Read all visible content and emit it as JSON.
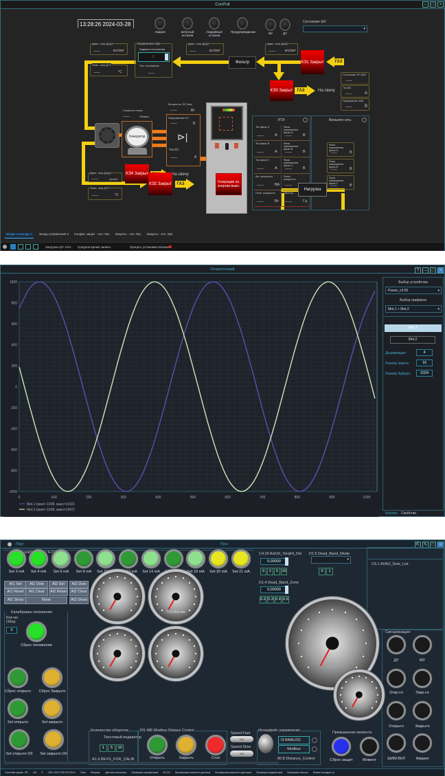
{
  "scada": {
    "title": "ConPult",
    "clock": "13:28:26  2024-03-28",
    "indicators": [
      "Авария",
      "Штатный останов",
      "Аварийный останов",
      "Предупреждение",
      "МУ",
      "ДУ"
    ],
    "state_label": "Состояние ШУ",
    "state_value": "",
    "sensors": {
      "dad3": {
        "label": "Давл. газа ДАД3",
        "unit": "кгс/см²"
      },
      "dt1": {
        "label": "Темп. газа ДТ1",
        "unit": "°C"
      },
      "dad2": {
        "label": "Давл. газа ДАД2",
        "unit": "кгс/см²"
      },
      "dad1": {
        "label": "Давл. газа ДАД1",
        "unit": "кгс/см²"
      },
      "dad4": {
        "label": "Давл. газа ДАД4",
        "unit": "кгс/см²"
      },
      "dt2": {
        "label": "Темп. газа ДТ2",
        "unit": "°C"
      }
    },
    "rd1": {
      "title": "Управление РД1",
      "setpoint_label": "Задание положения",
      "setpoint_value": "0",
      "pos_label": "Тек. положение"
    },
    "filter": "Фильтр",
    "valves": {
      "ke1": "КЭ1 Закрыт",
      "ke3": "КЭ3 Закрыт",
      "ke4": "КЭ4 Закрыт",
      "ke2": "КЭ2 Закрыт"
    },
    "gas": "ГАЗ",
    "to_candle": "На свечу",
    "battery": [
      {
        "label": "Состояние ЭУ АБЭ",
        "unit": ""
      },
      {
        "label": "Ток АБ",
        "unit": "A"
      },
      {
        "label": "Напряжение АКБ",
        "unit": "В"
      }
    ],
    "speed": {
      "label": "Скорость генер.",
      "unit": "Об/мин"
    },
    "generator": "Генератор",
    "converter": [
      {
        "label": "Мощность ЭС Вых",
        "unit": "Вт"
      },
      {
        "label": "Напряжение DC",
        "unit": "В"
      },
      {
        "label": "Ток DC",
        "unit": "A"
      }
    ],
    "gen_button": "Генерация эл. энергии выкл.",
    "upe": {
      "title": "УПЭ",
      "cells": [
        {
          "label": "Ток фазы A",
          "unit": "A"
        },
        {
          "label": "Фаза напряжения фазы A",
          "unit": "В"
        },
        {
          "label": "Ток фазы B",
          "unit": "A"
        },
        {
          "label": "Фаза напряжения фазы B",
          "unit": "В"
        },
        {
          "label": "Ток фазы C",
          "unit": "A"
        },
        {
          "label": "Фаза напряжения фазы C",
          "unit": "В"
        },
        {
          "label": "Акт. мощность",
          "unit": "ВА"
        },
        {
          "label": "Реакт. мощность",
          "unit": "ВАр"
        },
        {
          "label": "Полн. мощность",
          "unit": "Вт"
        },
        {
          "label": "Частота",
          "unit": "Гц"
        }
      ]
    },
    "grid": {
      "title": "Внешняя сеть",
      "cells": [
        {
          "label": "Фаза напряжения фазы A",
          "unit": "В"
        },
        {
          "label": "Фаза напряжения фазы B",
          "unit": "В"
        },
        {
          "label": "Фаза напряжения фазы C",
          "unit": "В"
        }
      ]
    },
    "load": "Нагрузка",
    "tabs": [
      "Входы и выходы 1",
      "Входы управления 2",
      "Конфиг. защит - хол. №1",
      "Защиты - хол. №1",
      "Защиты - хол. №2"
    ],
    "status": {
      "cpu": "Загрузка ЦП: 21%",
      "write": "Средняя время записи",
      "process": "Процесс установки питания"
    }
  },
  "scope": {
    "title": "Осциллограф",
    "device_label": "Выбор устройства",
    "device_value": "Power_v3.55",
    "graphs_label": "Выбор графиков",
    "graphs_value": "Mot.1 + Mot.2",
    "channels": [
      "Mot.1",
      "Mot.2"
    ],
    "decimation_label": "Дециммация",
    "decimation_value": "4",
    "packet_label": "Размер пакета",
    "packet_value": "16",
    "buffer_label": "Размер буфера",
    "buffer_value": "1024",
    "tabs": [
      "Каналы",
      "Свойства"
    ],
    "legend": [
      "Mot.1   (мин=-1008, макс=1010)",
      "Mot.2   (мин=-1008, макс=1007)"
    ]
  },
  "chart_data": {
    "type": "line",
    "title": "",
    "xlabel": "",
    "ylabel": "",
    "xlim": [
      0,
      1030
    ],
    "ylim": [
      -1000,
      1000
    ],
    "xticks": [
      0,
      100,
      200,
      300,
      400,
      500,
      600,
      700,
      800,
      900,
      1000
    ],
    "yticks": [
      -1000,
      -800,
      -600,
      -400,
      -200,
      0,
      200,
      400,
      600,
      800,
      1000
    ],
    "grid": true,
    "legend_position": "bottom-left",
    "x": [
      0,
      32,
      64,
      96,
      128,
      160,
      192,
      224,
      256,
      288,
      320,
      352,
      384,
      416,
      448,
      480,
      512,
      544,
      576,
      608,
      640,
      672,
      704,
      736,
      768,
      800,
      832,
      864,
      896,
      928,
      960,
      992,
      1024
    ],
    "series": [
      {
        "name": "Mot.1",
        "color": "#5b4fb0",
        "values": [
          746,
          947,
          997,
          888,
          637,
          285,
          -113,
          -493,
          -794,
          -969,
          -989,
          -851,
          -577,
          -212,
          187,
          557,
          838,
          985,
          975,
          809,
          514,
          138,
          -261,
          -618,
          -876,
          -995,
          -955,
          -762,
          -448,
          -63,
          333,
          675,
          910
        ]
      },
      {
        "name": "Mot.2",
        "color": "#cfe6b8",
        "values": [
          187,
          -212,
          -578,
          -851,
          -989,
          -969,
          -794,
          -493,
          -113,
          285,
          637,
          888,
          997,
          947,
          746,
          426,
          38,
          -356,
          -694,
          -920,
          -1000,
          -920,
          -694,
          -356,
          38,
          426,
          746,
          947,
          997,
          888,
          637,
          285,
          -113
        ]
      }
    ]
  },
  "control": {
    "top_left": "Порт",
    "top_center": "Пуск",
    "calib_title": "Калибровка AI 4-21",
    "set_lamps": [
      "Set 3 mA",
      "Set 4 mA",
      "Set 6 mA",
      "Set 8 mA",
      "Set 10 mA",
      "Set 12 mA",
      "Set 14 mA",
      "Set 16 mA",
      "Set 18 mA",
      "Set 20 mA",
      "Set 21 mA"
    ],
    "set_lamp_colors": [
      "#27e027",
      "#27e027",
      "#8ee08e",
      "#2f9a35",
      "#8ee08e",
      "#2f9a35",
      "#8ee08e",
      "#2f9a35",
      "#8ee08e",
      "#e8e620",
      "#e8e620"
    ],
    "ai_buttons": [
      "AI1 Set",
      "AI1 Dots",
      "AI2 Set",
      "AI2 Dots",
      "AI1 Reset",
      "AI1 Clear",
      "AI2 Reset",
      "AI2 Clear",
      "AI1 Show",
      "None",
      "AI2 Show"
    ],
    "gauge_label": "TCh Rot sek",
    "torq_label": "C4.29 AnCtrl_TorqFlt_Del",
    "torq_value": "0,00000",
    "torq_buttons": [
      "0",
      "2",
      "5",
      "10"
    ],
    "dbmode_label": "D1.5 Dead_Band_Mode",
    "dbmode_buttons": [
      "0",
      "1"
    ],
    "dbzone_label": "D1.4 Dead_Band_Zone",
    "dbzone_value": "0,00000",
    "dbzone_buttons": [
      "0.2",
      "0.3",
      "0.4",
      "0.5"
    ],
    "dots_list": "C6.1 AI/AO_Dots_List",
    "pos_calib": {
      "title": "Калибровка положения",
      "count_label": "Кол-во Обор",
      "count_value": "0",
      "lamps": [
        "Сброс положения",
        "Сброс открыто",
        "Сброс Закрыто",
        "Set открыто",
        "Set закрыто",
        "Set открыто Об",
        "Set закрыто Об"
      ]
    },
    "revs": {
      "title": "Количество оборотов",
      "indicator": "Текстовый индикатор",
      "buttons": [
        "1",
        "5",
        "10"
      ],
      "param": "A1.9 REVS_FOR_CALIB"
    },
    "rs485": {
      "title": "RS 485 Modbus Distace Control",
      "lamps": [
        "Открыть",
        "Закрыть",
        "Стоп"
      ],
      "speed_fast": "Speed Fast",
      "speed_slow": "Speed Slow",
      "toggle": "ON"
    },
    "iface": {
      "title": "Интерфейс управления",
      "analog": "I3 ANALOG",
      "modbus": "Modbus",
      "param": "80.8 Distance_Control"
    },
    "torque": {
      "title": "Превышение момента",
      "reset": "Сброс защит",
      "moment": "Момент"
    },
    "signals": {
      "title": "Сигнализация",
      "items": [
        "ДУ",
        "МУ",
        "Откр-ся",
        "Закр-ся",
        "Открыто",
        "Закрыто",
        "ШИМ ВКЛ",
        "Авария"
      ]
    },
    "statusbar": [
      "Система управ. ЭП",
      "АО",
      "0",
      "LED UDC FAN ECO/LA",
      "Токи",
      "Напряж.",
      "Датчик источника",
      "Проверка параметров",
      "DI DO",
      "Калибровка нижнего датчика",
      "Калибровка верхнего датчика",
      "Проверка индикатора",
      "Проверка насоса",
      "Новая посадка 1е"
    ]
  }
}
